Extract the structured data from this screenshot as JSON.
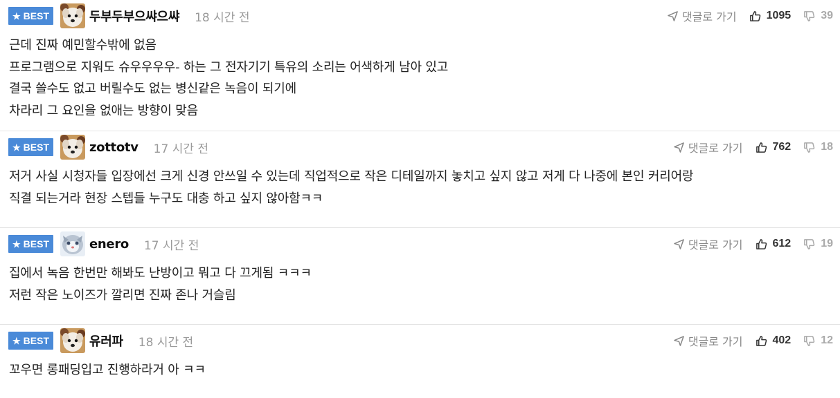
{
  "labels": {
    "best": "BEST",
    "reply": "댓글로 가기"
  },
  "colors": {
    "best_badge": "#4a8ad8"
  },
  "comments": [
    {
      "nickname": "두부두부으쌰으쌰",
      "time": "18 시간 전",
      "upvotes": "1095",
      "downvotes": "39",
      "avatar": "white-dog",
      "lines": [
        "근데 진짜 예민할수밖에 없음",
        "프로그램으로 지워도 슈우우우우- 하는 그 전자기기 특유의 소리는 어색하게 남아 있고",
        "결국 쓸수도 없고 버릴수도 없는 병신같은 녹음이 되기에",
        "차라리 그 요인을 없애는 방향이 맞음"
      ]
    },
    {
      "nickname": "zottotv",
      "time": "17 시간 전",
      "upvotes": "762",
      "downvotes": "18",
      "avatar": "white-dog",
      "lines": [
        "저거 사실 시청자들 입장에선 크게 신경 안쓰일 수 있는데 직업적으로 작은 디테일까지 놓치고 싶지 않고 저게 다 나중에 본인 커리어랑",
        "직결 되는거라 현장 스텝들 누구도 대충 하고 싶지 않아함ㅋㅋ"
      ]
    },
    {
      "nickname": "enero",
      "time": "17 시간 전",
      "upvotes": "612",
      "downvotes": "19",
      "avatar": "grey-cat",
      "lines": [
        "집에서 녹음 한번만 해봐도 난방이고 뭐고 다 끄게됨 ㅋㅋㅋ",
        "저런 작은 노이즈가 깔리면 진짜 존나 거슬림"
      ]
    },
    {
      "nickname": "유러파",
      "time": "18 시간 전",
      "upvotes": "402",
      "downvotes": "12",
      "avatar": "white-dog",
      "lines": [
        "꼬우면 롱패딩입고 진행하라거 아 ㅋㅋ"
      ]
    }
  ]
}
